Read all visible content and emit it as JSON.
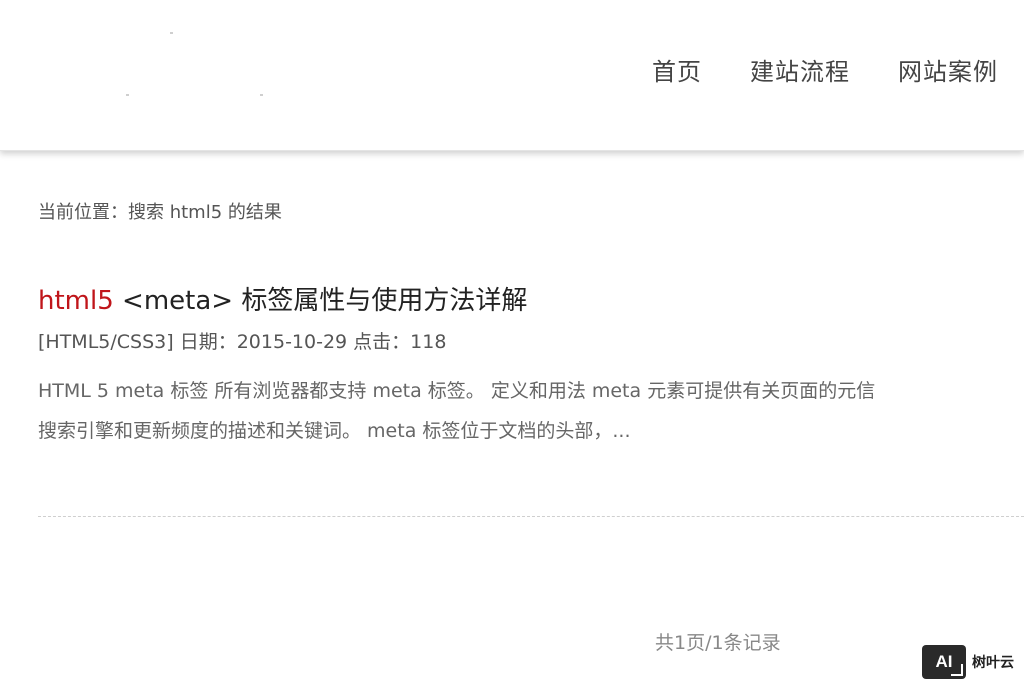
{
  "nav": {
    "items": [
      {
        "label": "首页"
      },
      {
        "label": "建站流程"
      },
      {
        "label": "网站案例"
      }
    ]
  },
  "breadcrumb": {
    "text": "当前位置：搜索 html5 的结果"
  },
  "result": {
    "title_keyword": "html5",
    "title_rest": " <meta> 标签属性与使用方法详解",
    "category": "[HTML5/CSS3]",
    "date_label": " 日期：2015-10-29 ",
    "clicks_label": "点击：118",
    "summary_line1": "HTML 5 meta 标签 所有浏览器都支持 meta 标签。 定义和用法 meta 元素可提供有关页面的元信",
    "summary_line2": "搜索引擎和更新频度的描述和关键词。 meta 标签位于文档的头部，..."
  },
  "pagination": {
    "text": "共1页/1条记录"
  },
  "watermark": {
    "badge": "AI",
    "text": "树叶云"
  },
  "colors": {
    "keyword": "#c0151a",
    "text": "#333333",
    "muted": "#888888"
  }
}
